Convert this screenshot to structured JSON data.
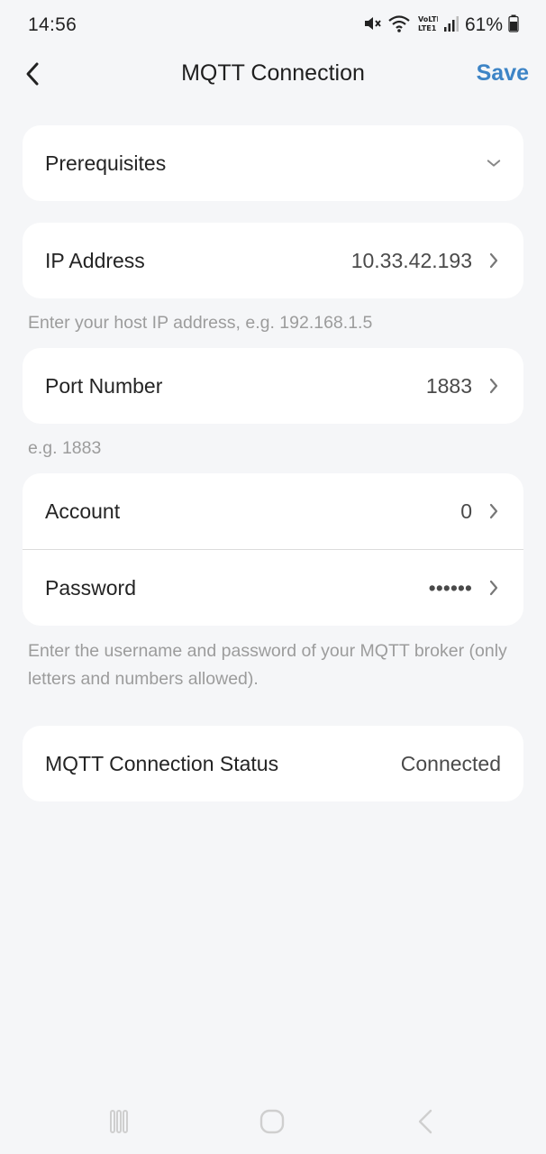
{
  "status_bar": {
    "time": "14:56",
    "battery_percent": "61%",
    "icons": [
      "mute-icon",
      "wifi-icon",
      "volte-icon",
      "signal-icon",
      "battery-icon"
    ]
  },
  "header": {
    "title": "MQTT Connection",
    "save_label": "Save",
    "back_icon": "chevron-left-icon"
  },
  "prerequisites": {
    "label": "Prerequisites",
    "icon": "chevron-down-icon"
  },
  "ip_address": {
    "label": "IP Address",
    "value": "10.33.42.193",
    "hint": "Enter your host IP address, e.g. 192.168.1.5"
  },
  "port": {
    "label": "Port Number",
    "value": "1883",
    "hint": "e.g. 1883"
  },
  "credentials": {
    "account_label": "Account",
    "account_value": "0",
    "password_label": "Password",
    "password_value": "••••••",
    "hint": "Enter the username and password of your MQTT broker (only letters and numbers allowed)."
  },
  "status": {
    "label": "MQTT Connection Status",
    "value": "Connected"
  },
  "nav": {
    "icons": [
      "recent-apps-icon",
      "home-icon",
      "back-icon"
    ]
  },
  "colors": {
    "accent": "#3d84c6",
    "background": "#f5f6f8",
    "card": "#ffffff",
    "hint": "#9c9c9c"
  }
}
